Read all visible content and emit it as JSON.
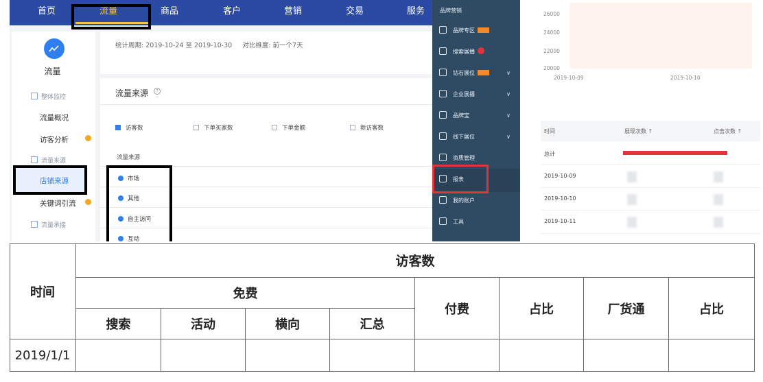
{
  "topnav": {
    "items": [
      "首页",
      "流量",
      "商品",
      "客户",
      "营销",
      "交易",
      "服务"
    ],
    "active": "流量"
  },
  "sidebar": {
    "title": "流量",
    "groups": [
      "整体监控",
      "流量来源",
      "流量承接"
    ],
    "items": [
      "流量概况",
      "访客分析",
      "店铺来源",
      "关键词引流"
    ],
    "active_item": "店铺来源"
  },
  "period": {
    "label": "统计周期:",
    "range": "2019-10-24 至 2019-10-30",
    "compare_label": "对比维度:",
    "compare_value": "前一个7天"
  },
  "source": {
    "title": "流量来源",
    "metrics": [
      "访客数",
      "下单买家数",
      "下单金额",
      "新访客数"
    ],
    "metrics_checked": [
      true,
      false,
      false,
      false
    ],
    "column_header": "流量来源",
    "rows": [
      "市场",
      "其他",
      "自主访问",
      "互动"
    ]
  },
  "menu": {
    "title": "品牌营销",
    "items": [
      "品牌专区",
      "搜索展播",
      "钻石展位",
      "企业展播",
      "品牌宝",
      "线下展位",
      "资质管理",
      "报表",
      "我的账户",
      "工具"
    ],
    "active": "报表",
    "icons": [
      "gift-icon",
      "search-icon",
      "diamond-icon",
      "monitor-icon",
      "bag-icon",
      "target-icon",
      "book-icon",
      "chart-icon",
      "card-icon",
      "wrench-icon"
    ]
  },
  "chart": {
    "y_ticks": [
      "26000",
      "24000",
      "22000",
      "20000"
    ],
    "x_ticks": [
      "2019-10-09",
      "2019-10-10"
    ]
  },
  "report_table": {
    "headers": [
      "时间",
      "展现次数 ↑",
      "点击次数 ↑"
    ],
    "rows": [
      "总计",
      "2019-10-09",
      "2019-10-10",
      "2019-10-11"
    ]
  },
  "sheet": {
    "title": "访客数",
    "time_header": "时间",
    "free_header": "免费",
    "free_sub": [
      "搜索",
      "活动",
      "横向",
      "汇总"
    ],
    "other_headers": [
      "付费",
      "占比",
      "厂货通",
      "占比"
    ],
    "first_row_date": "2019/1/1"
  },
  "colors": {
    "nav_bg": "#2b4aa3",
    "accent": "#2f7ff0",
    "highlight": "#e0353b",
    "menu_bg": "#2f4a63"
  }
}
